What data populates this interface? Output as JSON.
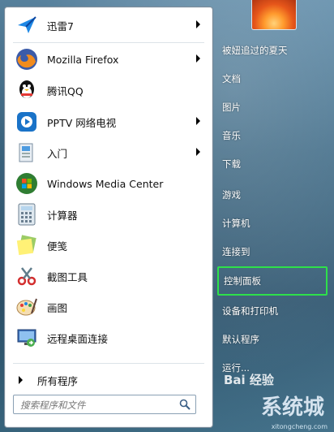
{
  "start_menu": {
    "pinned_items": [
      {
        "label": "迅雷7",
        "icon": "thunder-icon",
        "has_arrow": true
      },
      {
        "label": "Mozilla Firefox",
        "icon": "firefox-icon",
        "has_arrow": true
      },
      {
        "label": "腾讯QQ",
        "icon": "qq-penguin-icon",
        "has_arrow": false
      },
      {
        "label": "PPTV 网络电视",
        "icon": "pptv-icon",
        "has_arrow": true
      },
      {
        "label": "入门",
        "icon": "getting-started-icon",
        "has_arrow": true
      },
      {
        "label": "Windows Media Center",
        "icon": "media-center-icon",
        "has_arrow": false
      },
      {
        "label": "计算器",
        "icon": "calculator-icon",
        "has_arrow": false
      },
      {
        "label": "便笺",
        "icon": "sticky-notes-icon",
        "has_arrow": false
      },
      {
        "label": "截图工具",
        "icon": "snipping-tool-icon",
        "has_arrow": false
      },
      {
        "label": "画图",
        "icon": "paint-icon",
        "has_arrow": false
      },
      {
        "label": "远程桌面连接",
        "icon": "remote-desktop-icon",
        "has_arrow": false
      }
    ],
    "all_programs_label": "所有程序",
    "search": {
      "placeholder": "搜索程序和文件"
    },
    "right_items": [
      {
        "label": "被妞追过的夏天"
      },
      {
        "label": "文档"
      },
      {
        "label": "图片"
      },
      {
        "label": "音乐"
      },
      {
        "label": "下载"
      },
      {
        "label": "游戏"
      },
      {
        "label": "计算机"
      },
      {
        "label": "连接到"
      },
      {
        "label": "控制面板",
        "highlighted": true
      },
      {
        "label": "设备和打印机"
      },
      {
        "label": "默认程序"
      },
      {
        "label": "运行..."
      }
    ],
    "highlight_color": "#2ee04a"
  },
  "watermark": {
    "brand": "Bai 经验",
    "text": "系统城",
    "site": "xitongcheng.com"
  }
}
